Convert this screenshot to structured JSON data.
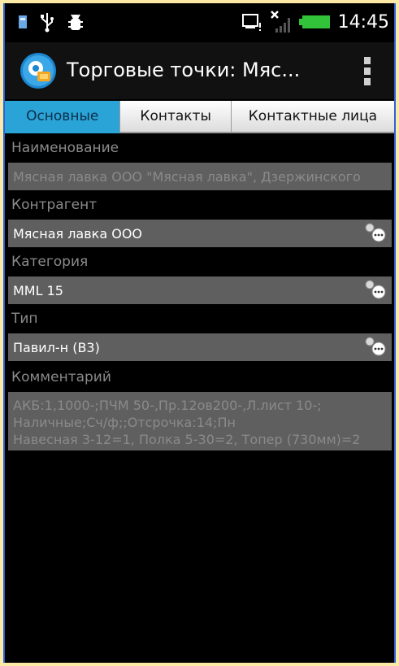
{
  "status_bar": {
    "time": "14:45",
    "icons": [
      "sim-icon",
      "usb-icon",
      "debug-icon",
      "sd-card-icon",
      "signal-icon",
      "battery-icon"
    ]
  },
  "action_bar": {
    "title": "Торговые точки: Мяс...",
    "menu_icon": "overflow-menu-icon"
  },
  "tabs": [
    {
      "label": "Основные",
      "active": true
    },
    {
      "label": "Контакты",
      "active": false
    },
    {
      "label": "Контактные лица",
      "active": false
    }
  ],
  "form": {
    "name_label": "Наименование",
    "name_value": "Мясная лавка ООО \"Мясная лавка\", Дзержинского",
    "counterparty_label": "Контрагент",
    "counterparty_value": "Мясная лавка ООО",
    "category_label": "Категория",
    "category_value": "MML 15",
    "type_label": "Тип",
    "type_value": "Павил-н (В3)",
    "comment_label": "Комментарий",
    "comment_lines": [
      "АКБ:1,1000-;ПЧМ 50-,Пр.12ов200-,Л.лист 10-;",
      "Наличные;Сч/ф;;Отсрочка:14;Пн",
      "Навесная 3-12=1, Полка 5-30=2, Топер (730мм)=2"
    ]
  },
  "colors": {
    "accent_tab": "#2aa3d6",
    "field_bg": "#5f5f5f",
    "label_gray": "#8a8a8a",
    "frame_border": "#2a63d8"
  }
}
